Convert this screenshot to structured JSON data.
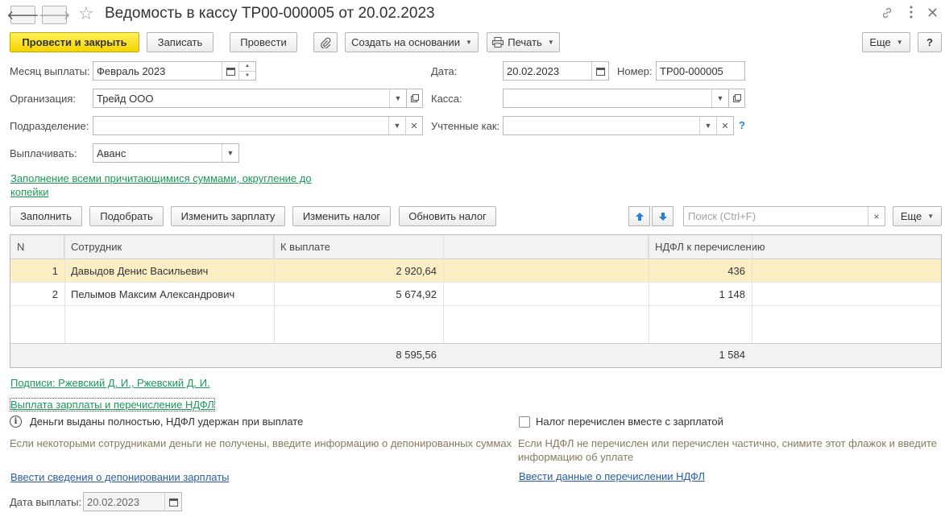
{
  "window": {
    "title": "Ведомость в кассу ТР00-000005 от 20.02.2023",
    "back_icon": "arrow-left-icon",
    "forward_icon": "arrow-right-icon",
    "favorite_icon": "star-icon",
    "link_icon": "link-icon",
    "menu_icon": "more-vertical-icon",
    "close_icon": "close-icon"
  },
  "toolbar": {
    "post_close": "Провести и закрыть",
    "save": "Записать",
    "post": "Провести",
    "attach_icon": "paperclip-icon",
    "create_based": "Создать на основании",
    "print": "Печать",
    "more": "Еще",
    "help": "?"
  },
  "form": {
    "month_label": "Месяц выплаты:",
    "month_value": "Февраль 2023",
    "date_label": "Дата:",
    "date_value": "20.02.2023",
    "number_label": "Номер:",
    "number_value": "ТР00-000005",
    "org_label": "Организация:",
    "org_value": "Трейд ООО",
    "cash_label": "Касса:",
    "cash_value": "",
    "dept_label": "Подразделение:",
    "dept_value": "",
    "counted_label": "Учтенные как:",
    "counted_value": "",
    "counted_help": "?",
    "pay_label": "Выплачивать:",
    "pay_value": "Аванс",
    "fill_link": "Заполнение всеми причитающимися суммами, округление до копейки"
  },
  "table_toolbar": {
    "fill": "Заполнить",
    "pick": "Подобрать",
    "change_salary": "Изменить зарплату",
    "change_tax": "Изменить налог",
    "refresh_tax": "Обновить налог",
    "search_placeholder": "Поиск (Ctrl+F)",
    "clear": "×",
    "more": "Еще"
  },
  "table": {
    "columns": [
      "N",
      "Сотрудник",
      "К выплате",
      "НДФЛ к перечислению"
    ],
    "rows": [
      {
        "n": "1",
        "employee": "Давыдов Денис Васильевич",
        "amount": "2 920,64",
        "tax": "436"
      },
      {
        "n": "2",
        "employee": "Пелымов Максим Александрович",
        "amount": "5 674,92",
        "tax": "1 148"
      }
    ],
    "totals": {
      "amount": "8 595,56",
      "tax": "1 584"
    }
  },
  "bottom": {
    "signatures_link": "Подписи: Ржевский Д. И., Ржевский Д. И.",
    "payment_link": "Выплата зарплаты и перечисление НДФЛ",
    "info_icon": "info-icon",
    "info_text": "Деньги выданы полностью, НДФЛ удержан при выплате",
    "hint_left": "Если некоторыми сотрудниками деньги не получены, введите информацию о депонированных суммах",
    "deposit_link": "Ввести сведения о депонировании зарплаты",
    "tax_checkbox_label": "Налог перечислен вместе с зарплатой",
    "tax_checkbox_checked": false,
    "hint_right": "Если НДФЛ не перечислен или перечислен частично, снимите этот флажок и введите информацию об уплате",
    "tax_link": "Ввести данные о перечислении НДФЛ",
    "pay_date_label": "Дата выплаты:",
    "pay_date_value": "20.02.2023"
  },
  "colors": {
    "primary_button": "#f5d400",
    "link_green": "#1a9a55",
    "link_blue": "#2a5ca8",
    "selected_row": "#fcefc6",
    "arrow_blue": "#2b7cd3"
  }
}
